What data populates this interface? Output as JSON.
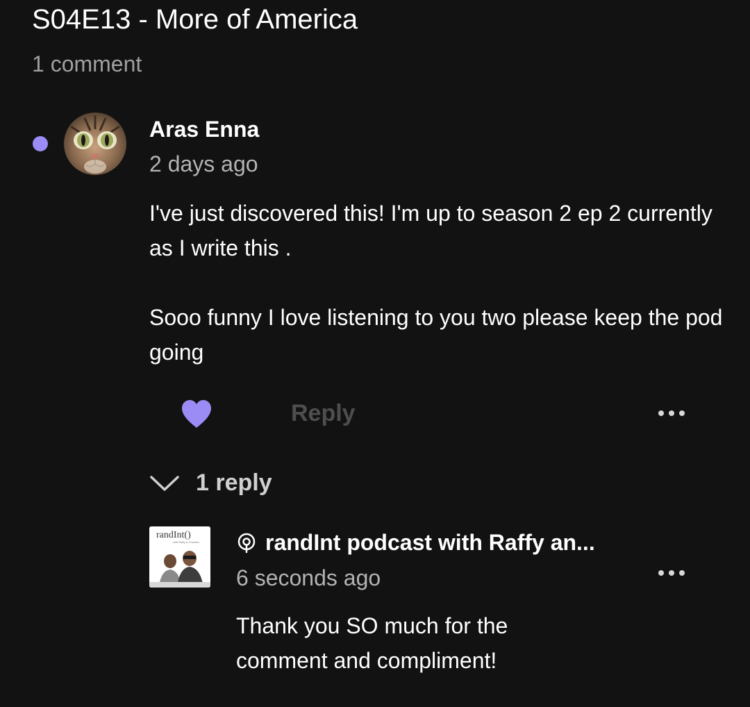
{
  "episode": {
    "title": "S04E13 - More of America",
    "comment_count": "1 comment"
  },
  "comment": {
    "author": "Aras Enna",
    "timestamp": "2 days ago",
    "paragraphs": [
      "I've just discovered this! I'm up to season 2 ep 2 currently as I write this .",
      "Sooo funny I love listening to you two please keep the pod  going"
    ],
    "liked": true,
    "reply_label": "Reply",
    "unread": true,
    "avatar_icon": "cat-face-avatar",
    "replies_toggle_label": "1 reply"
  },
  "reply": {
    "author": "randInt podcast with Raffy an...",
    "timestamp": "6 seconds ago",
    "body": "Thank you SO much for the comment and compliment!",
    "avatar_logo_text": "randInt()",
    "avatar_logo_subtext": "with Raffy & Chandra",
    "badge_icon": "podcast-creator-icon"
  },
  "colors": {
    "background": "#121212",
    "accent": "#9b8cf5",
    "muted_text": "#a0a0a0",
    "disabled_text": "#4e4e4e"
  }
}
